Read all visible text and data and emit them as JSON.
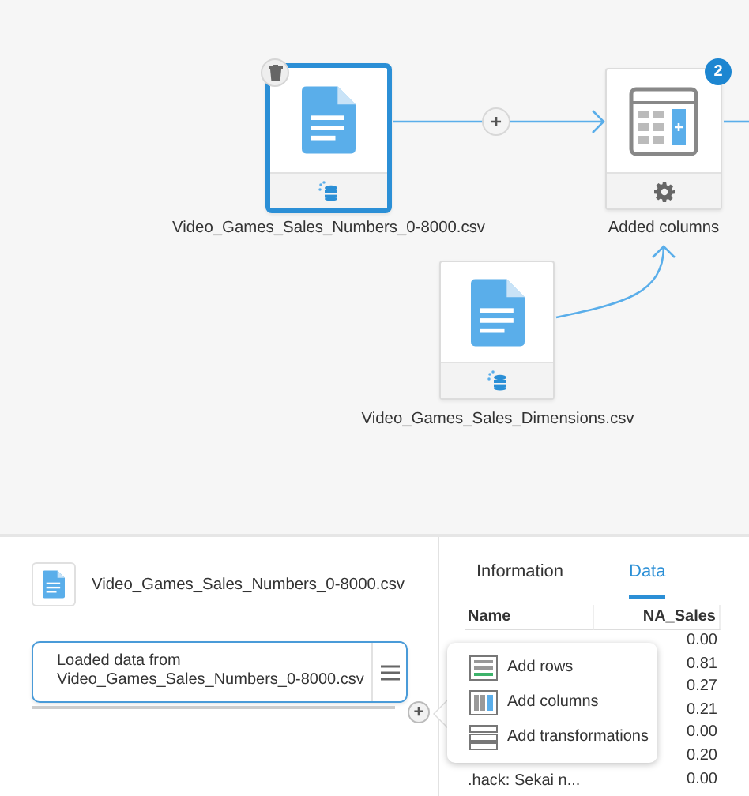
{
  "canvas": {
    "nodes": [
      {
        "kind": "file",
        "label": "Video_Games_Sales_Numbers_0-8000.csv",
        "selected": true
      },
      {
        "kind": "transform",
        "label": "Added columns",
        "badge": "2",
        "selected": false
      },
      {
        "kind": "file",
        "label": "Video_Games_Sales_Dimensions.csv",
        "selected": false
      }
    ],
    "add_button": "+"
  },
  "source": {
    "title": "Video_Games_Sales_Numbers_0-8000.csv",
    "steps": [
      {
        "label": "Loaded data from Video_Games_Sales_Numbers_0-8000.csv",
        "selected": true
      }
    ],
    "add_button": "+"
  },
  "tabs": [
    {
      "label": "Information",
      "selected": false
    },
    {
      "label": "Data",
      "selected": true
    }
  ],
  "table": {
    "columns": [
      "Name",
      "NA_Sales"
    ],
    "rows": [
      {
        "na_sales": "0.00"
      },
      {
        "na_sales": "0.81"
      },
      {
        "na_sales": "0.27"
      },
      {
        "na_sales": "0.21"
      },
      {
        "na_sales": "0.00"
      },
      {
        "na_sales": "0.20"
      },
      {
        "name": ".hack: Sekai n...",
        "na_sales": "0.00"
      }
    ]
  },
  "menu": {
    "items": [
      {
        "kind": "rows",
        "label": "Add rows"
      },
      {
        "kind": "columns",
        "label": "Add columns"
      },
      {
        "kind": "transformations",
        "label": "Add transformations"
      }
    ]
  }
}
